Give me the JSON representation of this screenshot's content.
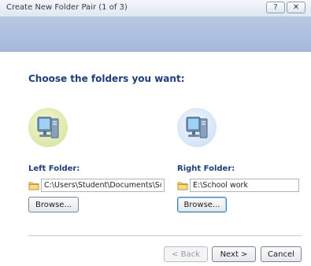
{
  "window": {
    "title": "Create New Folder Pair (1 of 3)",
    "help_glyph": "?",
    "close_glyph": "✕"
  },
  "content": {
    "heading": "Choose the folders you want:"
  },
  "left": {
    "label": "Left Folder:",
    "path": "C:\\Users\\Student\\Documents\\School",
    "browse_label": "Browse..."
  },
  "right": {
    "label": "Right Folder:",
    "path": "E:\\School work",
    "browse_label": "Browse..."
  },
  "footer": {
    "back_label": "< Back",
    "next_label": "Next >",
    "cancel_label": "Cancel"
  },
  "icons": {
    "left_pc": "computer-icon",
    "right_pc": "computer-icon",
    "folder": "folder-icon"
  }
}
